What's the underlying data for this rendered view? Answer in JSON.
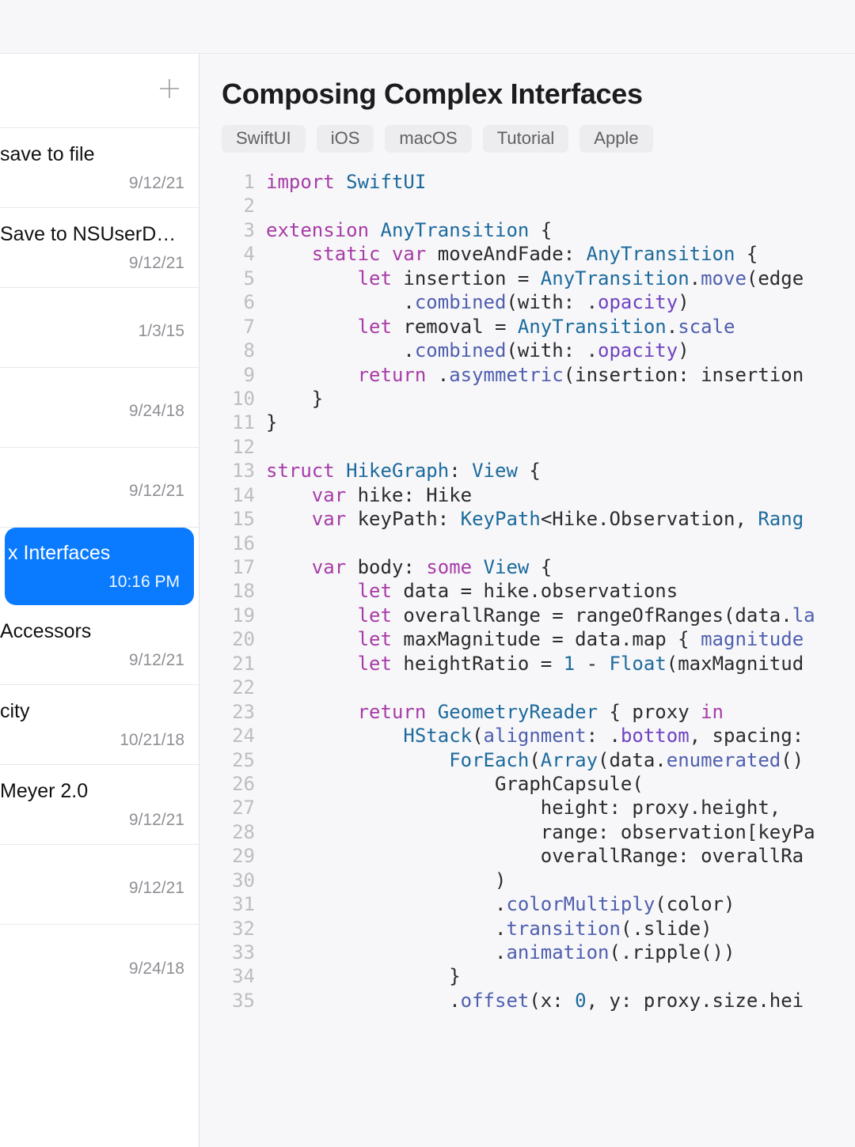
{
  "document": {
    "title": "Composing Complex Interfaces",
    "tags": [
      "SwiftUI",
      "iOS",
      "macOS",
      "Tutorial",
      "Apple"
    ]
  },
  "sidebar": {
    "items": [
      {
        "title": "save to file",
        "date": "9/12/21",
        "selected": false
      },
      {
        "title": "Save to NSUserD…",
        "date": "9/12/21",
        "selected": false
      },
      {
        "title": "",
        "date": "1/3/15",
        "selected": false
      },
      {
        "title": "",
        "date": "9/24/18",
        "selected": false
      },
      {
        "title": "",
        "date": "9/12/21",
        "selected": false
      },
      {
        "title": "x Interfaces",
        "date": "10:16 PM",
        "selected": true
      },
      {
        "title": "Accessors",
        "date": "9/12/21",
        "selected": false
      },
      {
        "title": "city",
        "date": "10/21/18",
        "selected": false
      },
      {
        "title": "Meyer 2.0",
        "date": "9/12/21",
        "selected": false
      },
      {
        "title": "",
        "date": "9/12/21",
        "selected": false
      },
      {
        "title": "",
        "date": "9/24/18",
        "selected": false
      }
    ]
  },
  "code": {
    "line_count": 35,
    "lines": [
      [
        [
          "kw",
          "import"
        ],
        [
          "sp",
          " "
        ],
        [
          "typ",
          "SwiftUI"
        ]
      ],
      [],
      [
        [
          "kw",
          "extension"
        ],
        [
          "sp",
          " "
        ],
        [
          "typ",
          "AnyTransition"
        ],
        [
          "sp",
          " {"
        ]
      ],
      [
        [
          "sp",
          "    "
        ],
        [
          "kw",
          "static"
        ],
        [
          "sp",
          " "
        ],
        [
          "kw",
          "var"
        ],
        [
          "sp",
          " moveAndFade: "
        ],
        [
          "typ",
          "AnyTransition"
        ],
        [
          "sp",
          " {"
        ]
      ],
      [
        [
          "sp",
          "        "
        ],
        [
          "kw",
          "let"
        ],
        [
          "sp",
          " insertion = "
        ],
        [
          "typ",
          "AnyTransition"
        ],
        [
          "sp",
          "."
        ],
        [
          "fn",
          "move"
        ],
        [
          "sp",
          "(edge"
        ]
      ],
      [
        [
          "sp",
          "            ."
        ],
        [
          "fn",
          "combined"
        ],
        [
          "sp",
          "(with: ."
        ],
        [
          "prop",
          "opacity"
        ],
        [
          "sp",
          ")"
        ]
      ],
      [
        [
          "sp",
          "        "
        ],
        [
          "kw",
          "let"
        ],
        [
          "sp",
          " removal = "
        ],
        [
          "typ",
          "AnyTransition"
        ],
        [
          "sp",
          "."
        ],
        [
          "fn",
          "scale"
        ]
      ],
      [
        [
          "sp",
          "            ."
        ],
        [
          "fn",
          "combined"
        ],
        [
          "sp",
          "(with: ."
        ],
        [
          "prop",
          "opacity"
        ],
        [
          "sp",
          ")"
        ]
      ],
      [
        [
          "sp",
          "        "
        ],
        [
          "kw",
          "return"
        ],
        [
          "sp",
          " ."
        ],
        [
          "fn",
          "asymmetric"
        ],
        [
          "sp",
          "(insertion: insertion"
        ]
      ],
      [
        [
          "sp",
          "    }"
        ]
      ],
      [
        [
          "sp",
          "}"
        ]
      ],
      [],
      [
        [
          "kw",
          "struct"
        ],
        [
          "sp",
          " "
        ],
        [
          "typ",
          "HikeGraph"
        ],
        [
          "sp",
          ": "
        ],
        [
          "typ",
          "View"
        ],
        [
          "sp",
          " {"
        ]
      ],
      [
        [
          "sp",
          "    "
        ],
        [
          "kw",
          "var"
        ],
        [
          "sp",
          " hike: Hike"
        ]
      ],
      [
        [
          "sp",
          "    "
        ],
        [
          "kw",
          "var"
        ],
        [
          "sp",
          " keyPath: "
        ],
        [
          "typ",
          "KeyPath"
        ],
        [
          "sp",
          "<Hike.Observation, "
        ],
        [
          "typ",
          "Rang"
        ]
      ],
      [],
      [
        [
          "sp",
          "    "
        ],
        [
          "kw",
          "var"
        ],
        [
          "sp",
          " body: "
        ],
        [
          "kw",
          "some"
        ],
        [
          "sp",
          " "
        ],
        [
          "typ",
          "View"
        ],
        [
          "sp",
          " {"
        ]
      ],
      [
        [
          "sp",
          "        "
        ],
        [
          "kw",
          "let"
        ],
        [
          "sp",
          " data = hike.observations"
        ]
      ],
      [
        [
          "sp",
          "        "
        ],
        [
          "kw",
          "let"
        ],
        [
          "sp",
          " overallRange = rangeOfRanges(data."
        ],
        [
          "fn",
          "la"
        ]
      ],
      [
        [
          "sp",
          "        "
        ],
        [
          "kw",
          "let"
        ],
        [
          "sp",
          " maxMagnitude = data.map { "
        ],
        [
          "fn",
          "magnitude"
        ]
      ],
      [
        [
          "sp",
          "        "
        ],
        [
          "kw",
          "let"
        ],
        [
          "sp",
          " heightRatio = "
        ],
        [
          "num",
          "1"
        ],
        [
          "sp",
          " - "
        ],
        [
          "typ",
          "Float"
        ],
        [
          "sp",
          "(maxMagnitud"
        ]
      ],
      [],
      [
        [
          "sp",
          "        "
        ],
        [
          "kw",
          "return"
        ],
        [
          "sp",
          " "
        ],
        [
          "typ",
          "GeometryReader"
        ],
        [
          "sp",
          " { proxy "
        ],
        [
          "kw",
          "in"
        ]
      ],
      [
        [
          "sp",
          "            "
        ],
        [
          "typ",
          "HStack"
        ],
        [
          "sp",
          "("
        ],
        [
          "fn",
          "alignment"
        ],
        [
          "sp",
          ": ."
        ],
        [
          "prop",
          "bottom"
        ],
        [
          "sp",
          ", spacing:"
        ]
      ],
      [
        [
          "sp",
          "                "
        ],
        [
          "typ",
          "ForEach"
        ],
        [
          "sp",
          "("
        ],
        [
          "typ",
          "Array"
        ],
        [
          "sp",
          "(data."
        ],
        [
          "fn",
          "enumerated"
        ],
        [
          "sp",
          "()"
        ]
      ],
      [
        [
          "sp",
          "                    GraphCapsule("
        ]
      ],
      [
        [
          "sp",
          "                        height: proxy.height,"
        ]
      ],
      [
        [
          "sp",
          "                        range: observation[keyPa"
        ]
      ],
      [
        [
          "sp",
          "                        overallRange: overallRa"
        ]
      ],
      [
        [
          "sp",
          "                    )"
        ]
      ],
      [
        [
          "sp",
          "                    ."
        ],
        [
          "fn",
          "colorMultiply"
        ],
        [
          "sp",
          "(color)"
        ]
      ],
      [
        [
          "sp",
          "                    ."
        ],
        [
          "fn",
          "transition"
        ],
        [
          "sp",
          "(.slide)"
        ]
      ],
      [
        [
          "sp",
          "                    ."
        ],
        [
          "fn",
          "animation"
        ],
        [
          "sp",
          "(.ripple())"
        ]
      ],
      [
        [
          "sp",
          "                }"
        ]
      ],
      [
        [
          "sp",
          "                ."
        ],
        [
          "fn",
          "offset"
        ],
        [
          "sp",
          "(x: "
        ],
        [
          "num",
          "0"
        ],
        [
          "sp",
          ", y: proxy.size.hei"
        ]
      ]
    ]
  }
}
